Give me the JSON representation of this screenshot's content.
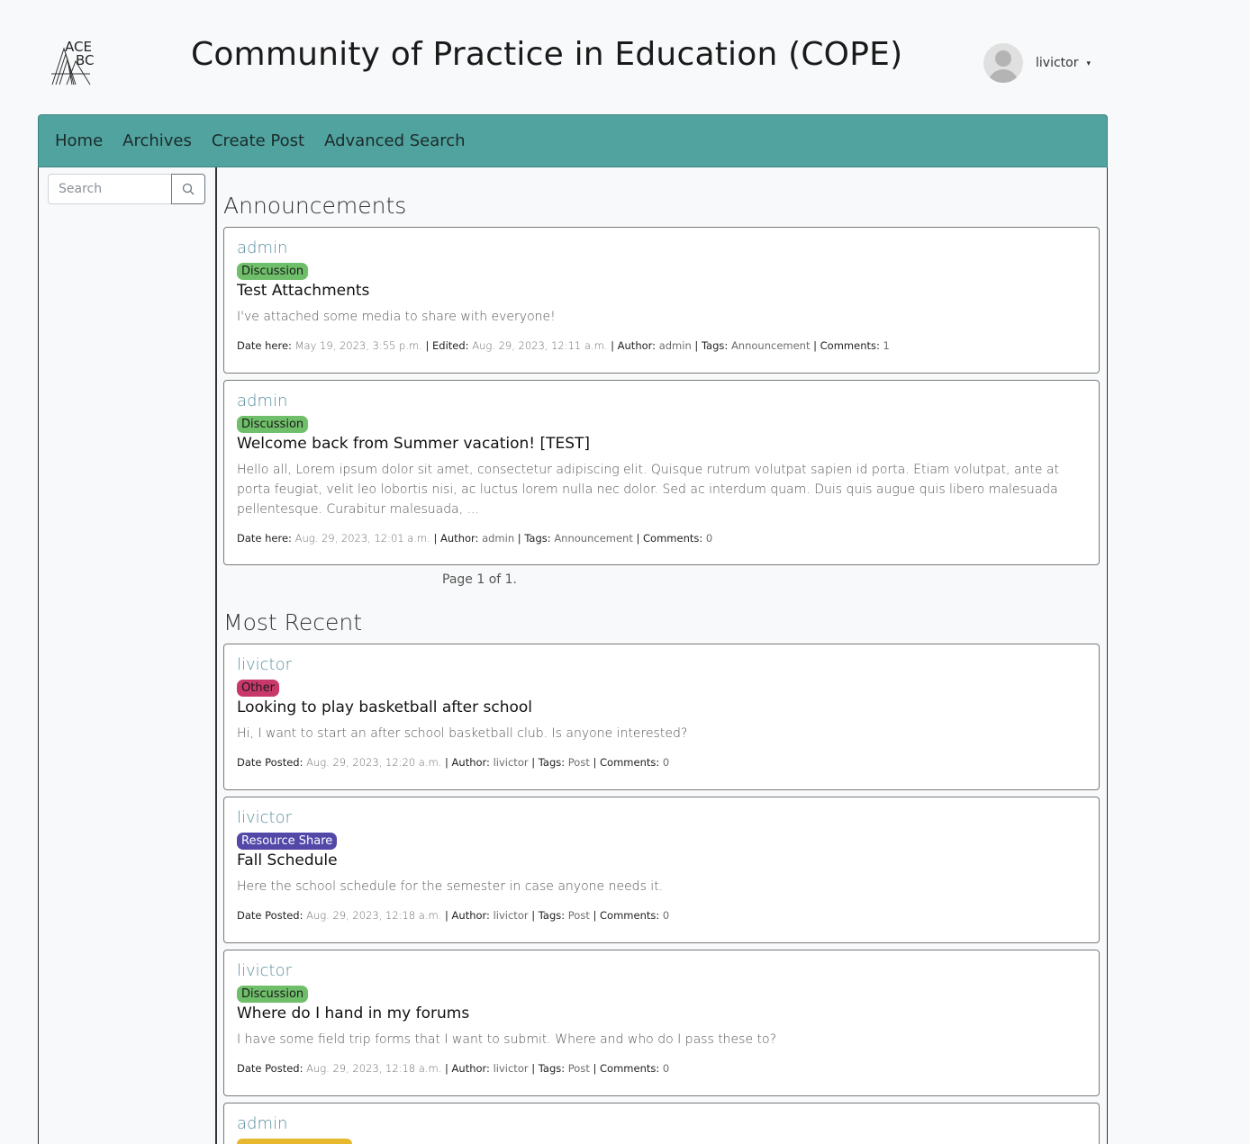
{
  "header": {
    "logo_text_top": "ACE",
    "logo_text_bottom": "BC",
    "site_title": "Community of Practice in Education (COPE)",
    "username": "livictor",
    "caret": "▾"
  },
  "nav": {
    "items": [
      {
        "label": "Home"
      },
      {
        "label": "Archives"
      },
      {
        "label": "Create Post"
      },
      {
        "label": "Advanced Search"
      }
    ]
  },
  "sidebar": {
    "search_placeholder": "Search"
  },
  "announcements": {
    "heading": "Announcements",
    "pagination": "Page 1 of 1.",
    "posts": [
      {
        "author": "admin",
        "category": "Discussion",
        "title": "Test Attachments",
        "excerpt": "I've attached some media to share with everyone!",
        "date_label": "Date here:",
        "date": "May 19, 2023, 3:55 p.m.",
        "edited_label": "Edited:",
        "edited": "Aug. 29, 2023, 12:11 a.m.",
        "author_label": "Author:",
        "author_value": "admin",
        "tags_label": "Tags:",
        "tags": "Announcement",
        "comments_label": "Comments:",
        "comments": "1"
      },
      {
        "author": "admin",
        "category": "Discussion",
        "title": "Welcome back from Summer vacation! [TEST]",
        "excerpt": "Hello all, Lorem ipsum dolor sit amet, consectetur adipiscing elit. Quisque rutrum volutpat sapien id porta. Etiam volutpat, ante at porta feugiat, velit leo lobortis nisi, ac luctus lorem nulla nec dolor. Sed ac interdum quam. Duis quis augue quis libero malesuada pellentesque. Curabitur malesuada, ...",
        "date_label": "Date here:",
        "date": "Aug. 29, 2023, 12:01 a.m.",
        "author_label": "Author:",
        "author_value": "admin",
        "tags_label": "Tags:",
        "tags": "Announcement",
        "comments_label": "Comments:",
        "comments": "0"
      }
    ]
  },
  "recent": {
    "heading": "Most Recent",
    "posts": [
      {
        "author": "livictor",
        "category": "Other",
        "title": "Looking to play basketball after school",
        "excerpt": "Hi, I want to start an after school basketball club. Is anyone interested?",
        "date_label": "Date Posted:",
        "date": "Aug. 29, 2023, 12:20 a.m.",
        "author_label": "Author:",
        "author_value": "livictor",
        "tags_label": "Tags:",
        "tags": "Post",
        "comments_label": "Comments:",
        "comments": "0"
      },
      {
        "author": "livictor",
        "category": "Resource Share",
        "title": "Fall Schedule",
        "excerpt": "Here the school schedule for the semester in case anyone needs it.",
        "date_label": "Date Posted:",
        "date": "Aug. 29, 2023, 12:18 a.m.",
        "author_label": "Author:",
        "author_value": "livictor",
        "tags_label": "Tags:",
        "tags": "Post",
        "comments_label": "Comments:",
        "comments": "0"
      },
      {
        "author": "livictor",
        "category": "Discussion",
        "title": "Where do I hand in my forums",
        "excerpt": "I have some field trip forms that I want to submit. Where and who do I pass these to?",
        "date_label": "Date Posted:",
        "date": "Aug. 29, 2023, 12:18 a.m.",
        "author_label": "Author:",
        "author_value": "livictor",
        "tags_label": "Tags:",
        "tags": "Post",
        "comments_label": "Comments:",
        "comments": "0"
      },
      {
        "author": "admin"
      }
    ]
  }
}
